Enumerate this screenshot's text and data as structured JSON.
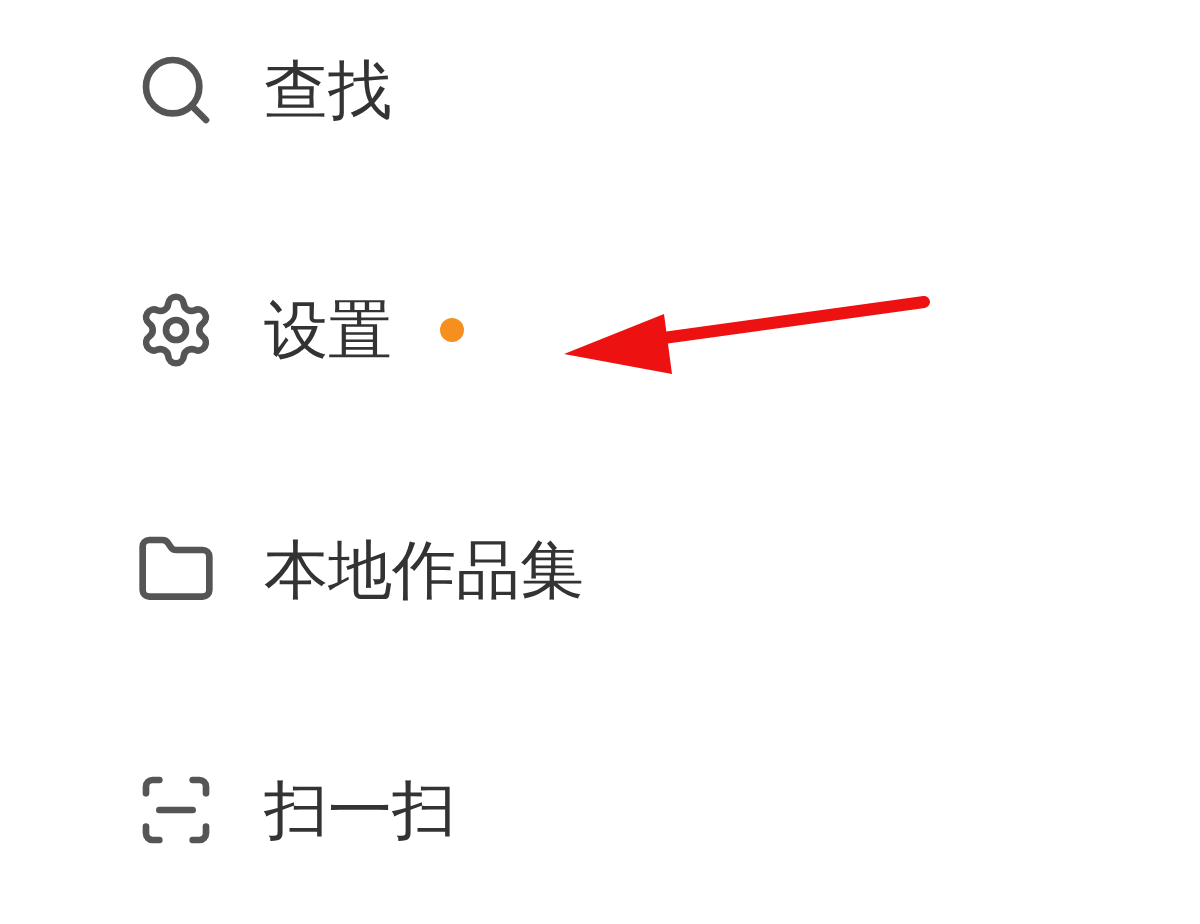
{
  "menu": {
    "items": [
      {
        "kind": "search",
        "label": "查找",
        "badge_dot": false
      },
      {
        "kind": "settings",
        "label": "设置",
        "badge_dot": true
      },
      {
        "kind": "folder",
        "label": "本地作品集",
        "badge_dot": false
      },
      {
        "kind": "scan",
        "label": "扫一扫",
        "badge_dot": false
      }
    ]
  },
  "annotations": [
    {
      "kind": "arrow"
    }
  ]
}
